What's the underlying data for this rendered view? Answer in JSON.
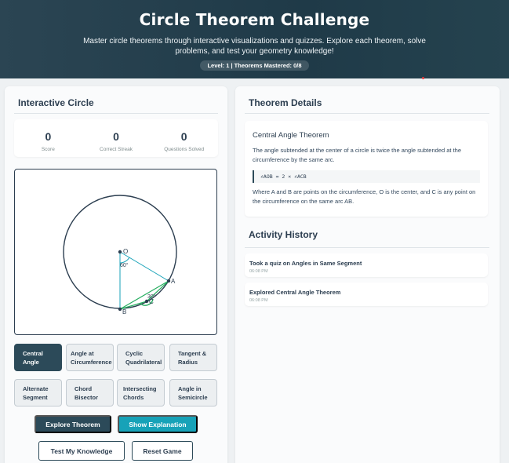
{
  "header": {
    "title": "Circle Theorem Challenge",
    "subtitle": "Master circle theorems through interactive visualizations and quizzes. Explore each theorem, solve problems, and test your geometry knowledge!",
    "badge": "Level: 1 | Theorems Mastered: 0/8"
  },
  "left_panel": {
    "title": "Interactive Circle",
    "stats": [
      {
        "value": "0",
        "label": "Score"
      },
      {
        "value": "0",
        "label": "Correct Streak"
      },
      {
        "value": "0",
        "label": "Questions Solved"
      }
    ],
    "diagram": {
      "center_label": "O",
      "point_a_label": "A",
      "point_b_label": "B",
      "point_c_label": "C",
      "center_angle": "60°",
      "circ_angle": "30°"
    },
    "theorem_buttons": [
      {
        "line1": "Central",
        "line2": "Angle",
        "active": true
      },
      {
        "line1": "Angle at",
        "line2": "Circumference",
        "active": false
      },
      {
        "line1": "Cyclic",
        "line2": "Quadrilateral",
        "active": false
      },
      {
        "line1": "Tangent &",
        "line2": "Radius",
        "active": false
      },
      {
        "line1": "Alternate",
        "line2": "Segment",
        "active": false
      },
      {
        "line1": "Chord",
        "line2": "Bisector",
        "active": false
      },
      {
        "line1": "Intersecting",
        "line2": "Chords",
        "active": false
      },
      {
        "line1": "Angle in",
        "line2": "Semicircle",
        "active": false
      }
    ],
    "actions": {
      "explore": "Explore Theorem",
      "explain": "Show Explanation",
      "test": "Test My Knowledge",
      "reset": "Reset Game"
    }
  },
  "right_panel": {
    "title": "Theorem Details",
    "theorem": {
      "name": "Central Angle Theorem",
      "description": "The angle subtended at the center of a circle is twice the angle subtended at the circumference by the same arc.",
      "formula": "∠AOB = 2 × ∠ACB",
      "note": "Where A and B are points on the circumference, O is the center, and C is any point on the circumference on the same arc AB."
    },
    "history_title": "Activity History",
    "history": [
      {
        "title": "Took a quiz on Angles in Same Segment",
        "time": "06:08 PM"
      },
      {
        "title": "Explored Central Angle Theorem",
        "time": "06:08 PM"
      }
    ]
  },
  "colors": {
    "primary": "#2c4a59",
    "teal": "#17a2b8",
    "green": "#27ae60",
    "circle": "#2c3e50"
  }
}
